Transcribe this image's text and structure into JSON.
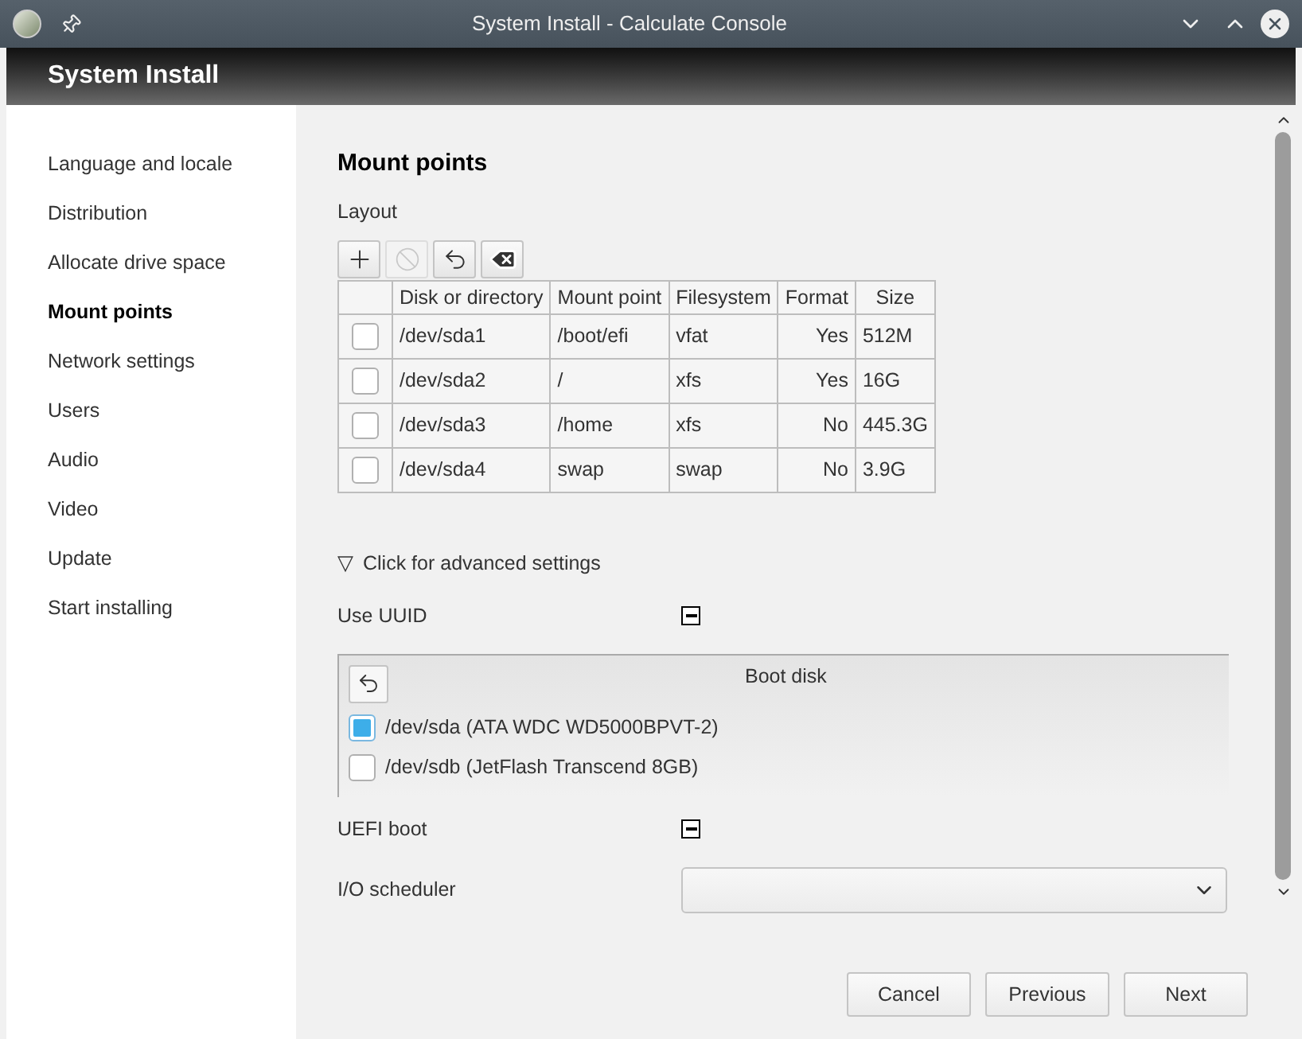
{
  "window": {
    "title": "System Install - Calculate Console"
  },
  "header": {
    "title": "System Install"
  },
  "sidebar": {
    "items": [
      {
        "label": "Language and locale",
        "selected": false
      },
      {
        "label": "Distribution",
        "selected": false
      },
      {
        "label": "Allocate drive space",
        "selected": false
      },
      {
        "label": "Mount points",
        "selected": true
      },
      {
        "label": "Network settings",
        "selected": false
      },
      {
        "label": "Users",
        "selected": false
      },
      {
        "label": "Audio",
        "selected": false
      },
      {
        "label": "Video",
        "selected": false
      },
      {
        "label": "Update",
        "selected": false
      },
      {
        "label": "Start installing",
        "selected": false
      }
    ]
  },
  "page": {
    "title": "Mount points",
    "layout_label": "Layout",
    "toolbar": [
      {
        "kind": "add",
        "disabled": false
      },
      {
        "kind": "block",
        "disabled": true
      },
      {
        "kind": "undo",
        "disabled": false
      },
      {
        "kind": "delete",
        "disabled": false
      }
    ],
    "table": {
      "columns": [
        "Disk or directory",
        "Mount point",
        "Filesystem",
        "Format",
        "Size"
      ],
      "rows": [
        {
          "checked": false,
          "cells": [
            "/dev/sda1",
            "/boot/efi",
            "vfat",
            "Yes",
            "512M"
          ]
        },
        {
          "checked": false,
          "cells": [
            "/dev/sda2",
            "/",
            "xfs",
            "Yes",
            "16G"
          ]
        },
        {
          "checked": false,
          "cells": [
            "/dev/sda3",
            "/home",
            "xfs",
            "No",
            "445.3G"
          ]
        },
        {
          "checked": false,
          "cells": [
            "/dev/sda4",
            "swap",
            "swap",
            "No",
            "3.9G"
          ]
        }
      ]
    },
    "advanced": {
      "toggle": "▽",
      "label": "Click for advanced settings"
    },
    "use_uuid": {
      "label": "Use UUID",
      "indeterminate": true
    },
    "boot_disk": {
      "title": "Boot disk",
      "options": [
        {
          "label": "/dev/sda (ATA WDC WD5000BPVT-2)",
          "checked": true
        },
        {
          "label": "/dev/sdb (JetFlash Transcend 8GB)",
          "checked": false
        }
      ]
    },
    "uefi_boot": {
      "label": "UEFI boot",
      "indeterminate": true
    },
    "io_scheduler": {
      "label": "I/O scheduler"
    }
  },
  "buttons": [
    "Cancel",
    "Previous",
    "Next"
  ]
}
